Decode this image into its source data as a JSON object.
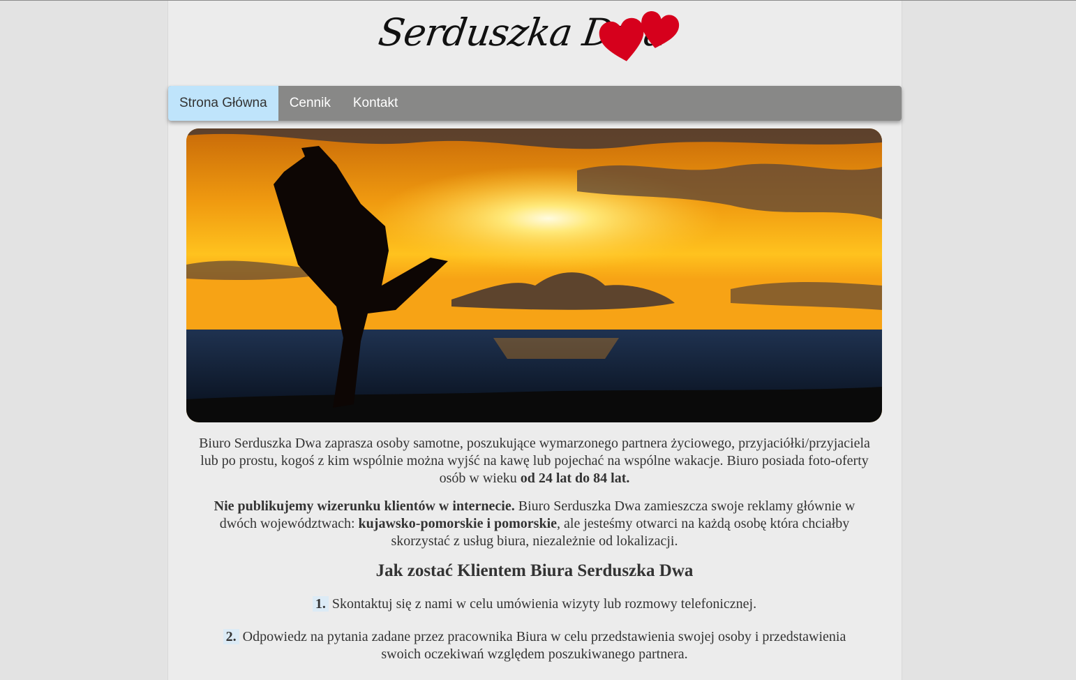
{
  "header": {
    "logo_text": "Serduszka Dwa",
    "logo_icon": "two-hearts-icon"
  },
  "nav": {
    "items": [
      {
        "label": "Strona Główna",
        "active": true
      },
      {
        "label": "Cennik",
        "active": false
      },
      {
        "label": "Kontakt",
        "active": false
      }
    ]
  },
  "hero": {
    "alt": "sunset-couple-silhouette"
  },
  "intro": {
    "p1_text": "Biuro Serduszka Dwa zaprasza osoby samotne, poszukujące wymarzonego partnera życiowego, przyjaciółki/przyjaciela lub po prostu, kogoś z kim wspólnie można wyjść na kawę lub pojechać na wspólne wakacje. Biuro posiada foto-oferty osób w wieku ",
    "p1_bold": "od 24 lat do 84 lat.",
    "p2_bold1": "Nie publikujemy wizerunku klientów w internecie.",
    "p2_text1": " Biuro Serduszka Dwa zamieszcza swoje reklamy głównie w dwóch województwach: ",
    "p2_bold2": "kujawsko-pomorskie i pomorskie",
    "p2_text2": ", ale jesteśmy otwarci na każdą osobę która chciałby skorzystać z usług biura, niezależnie od lokalizacji."
  },
  "how_to": {
    "heading": "Jak zostać Klientem Biura Serduszka Dwa",
    "steps": [
      {
        "num": "1.",
        "text": " Skontaktuj się z nami w celu umówienia wizyty lub rozmowy telefonicznej."
      },
      {
        "num": "2.",
        "text": " Odpowiedz na pytania zadane przez pracownika Biura w celu przedstawienia swojej osoby i przedstawienia swoich oczekiwań względem poszukiwanego partnera."
      }
    ]
  },
  "colors": {
    "nav_bg": "#888887",
    "nav_active_bg": "#bfe4fb",
    "heart_red": "#d6001c",
    "page_bg": "#ececec"
  }
}
